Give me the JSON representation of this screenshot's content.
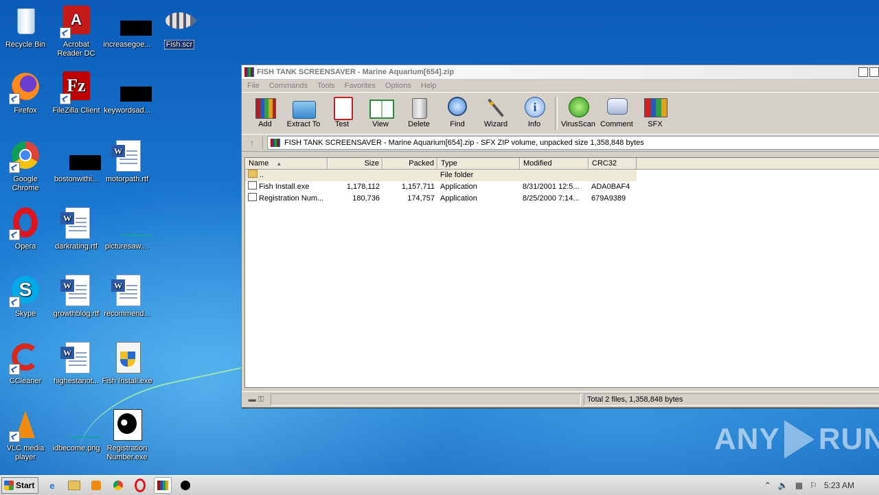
{
  "desktop": {
    "icons": [
      {
        "label": "Recycle Bin"
      },
      {
        "label": "Acrobat Reader DC"
      },
      {
        "label": "increasegoe..."
      },
      {
        "label": "Fish.scr"
      },
      {
        "label": "Firefox"
      },
      {
        "label": "FileZilla Client"
      },
      {
        "label": "keywordsad..."
      },
      {
        "label": "Google Chrome"
      },
      {
        "label": "bostonwithi..."
      },
      {
        "label": "motorpath.rtf"
      },
      {
        "label": "Opera"
      },
      {
        "label": "darkrating.rtf"
      },
      {
        "label": "picturesaw...."
      },
      {
        "label": "Skype"
      },
      {
        "label": "growthblog.rtf"
      },
      {
        "label": "recommend..."
      },
      {
        "label": "CCleaner"
      },
      {
        "label": "highestanot..."
      },
      {
        "label": "Fish Install.exe"
      },
      {
        "label": "VLC media player"
      },
      {
        "label": "idbecome.png"
      },
      {
        "label": "Registration Number.exe"
      }
    ]
  },
  "window": {
    "title": "FISH TANK SCREENSAVER - Marine Aquarium[654].zip",
    "menu": [
      "File",
      "Commands",
      "Tools",
      "Favorites",
      "Options",
      "Help"
    ],
    "toolbar": [
      "Add",
      "Extract To",
      "Test",
      "View",
      "Delete",
      "Find",
      "Wizard",
      "Info",
      "VirusScan",
      "Comment",
      "SFX"
    ],
    "address": "FISH TANK SCREENSAVER - Marine Aquarium[654].zip - SFX ZIP volume, unpacked size 1,358,848 bytes",
    "columns": [
      "Name",
      "Size",
      "Packed",
      "Type",
      "Modified",
      "CRC32"
    ],
    "parent_row": {
      "name": "..",
      "type": "File folder"
    },
    "rows": [
      {
        "name": "Fish Install.exe",
        "size": "1,178,112",
        "packed": "1,157,711",
        "type": "Application",
        "modified": "8/31/2001 12:5...",
        "crc": "ADA0BAF4"
      },
      {
        "name": "Registration Num...",
        "size": "180,736",
        "packed": "174,757",
        "type": "Application",
        "modified": "8/25/2000 7:14...",
        "crc": "679A9389"
      }
    ],
    "status": "Total 2 files, 1,358,848 bytes"
  },
  "watermark": {
    "left": "ANY",
    "right": "RUN"
  },
  "taskbar": {
    "start": "Start",
    "clock": "5:23 AM"
  }
}
